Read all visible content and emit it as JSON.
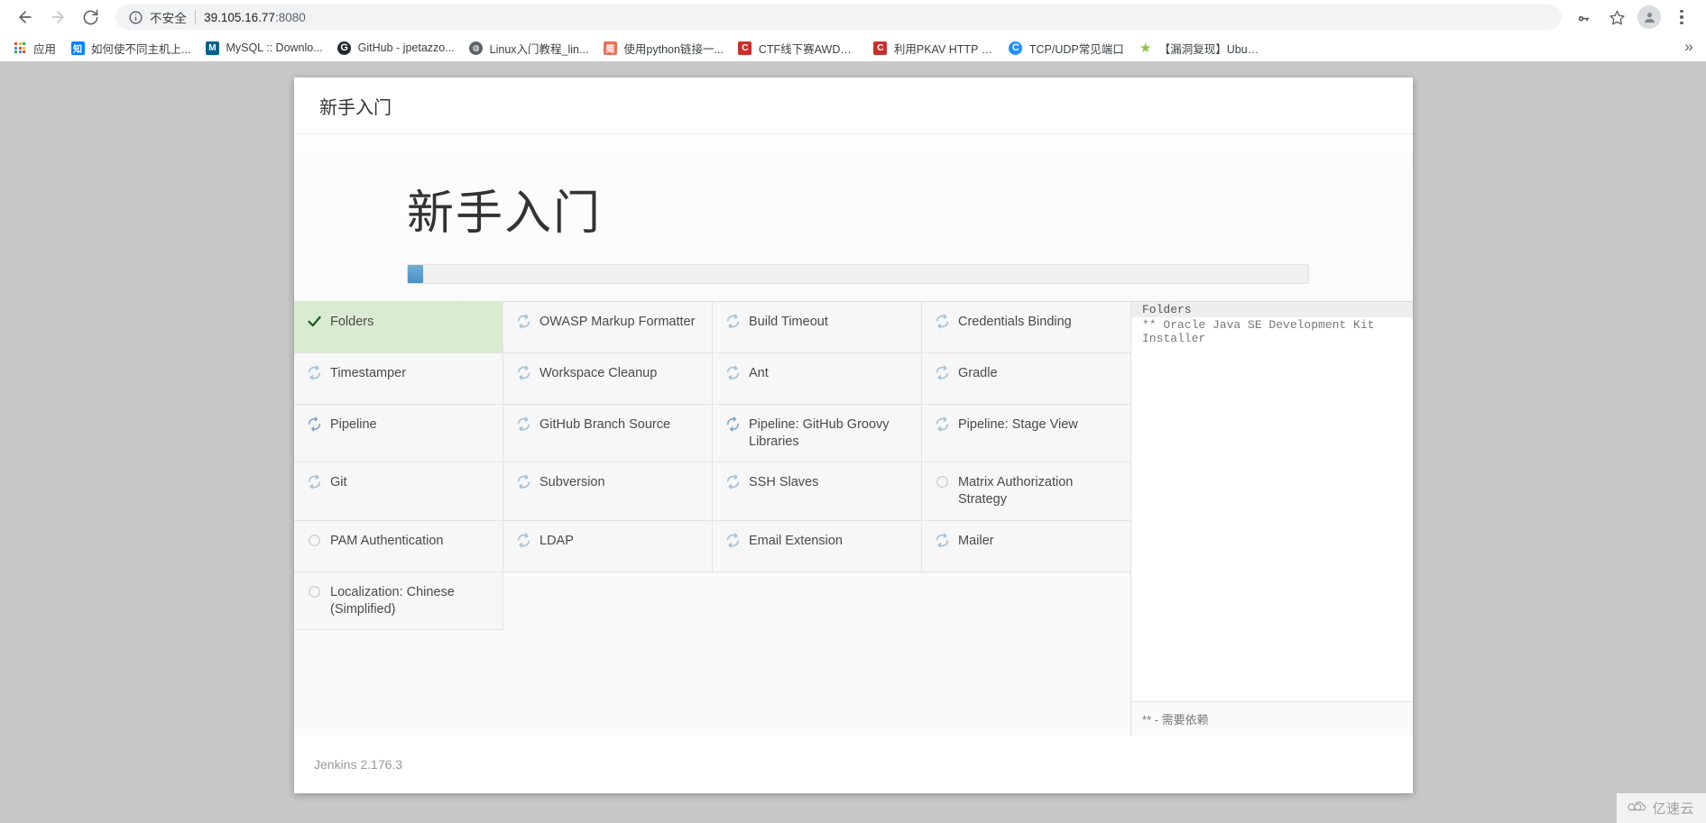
{
  "browser": {
    "back_label": "back-arrow",
    "forward_label": "forward-arrow",
    "reload_label": "reload",
    "security_text": "不安全",
    "url_host": "39.105.16.77",
    "url_port": ":8080",
    "key_icon": "password-key-icon",
    "star_icon": "bookmark-star-icon",
    "avatar_icon": "profile-avatar",
    "menu_icon": "three-dot-menu",
    "overflow_label": "»"
  },
  "bookmarks": {
    "apps_label": "应用",
    "items": [
      {
        "label": "如何使不同主机上...",
        "icon": "zhihu-icon",
        "color": "#1772f6",
        "glyph": "知"
      },
      {
        "label": "MySQL :: Downlo...",
        "icon": "mysql-icon",
        "color": "#00618a",
        "glyph": "M"
      },
      {
        "label": "GitHub - jpetazzo...",
        "icon": "github-icon",
        "color": "#24292e",
        "glyph": "G"
      },
      {
        "label": "Linux入门教程_lin...",
        "icon": "globe-icon",
        "color": "#4a4a4a",
        "glyph": "🌐"
      },
      {
        "label": "使用python链接一...",
        "icon": "jianshu-icon",
        "color": "#ea6f5a",
        "glyph": "简"
      },
      {
        "label": "CTF线下赛AWD总...",
        "icon": "csdn-icon",
        "color": "#c9302c",
        "glyph": "C"
      },
      {
        "label": "利用PKAV HTTP F...",
        "icon": "csdn-icon",
        "color": "#c9302c",
        "glyph": "C"
      },
      {
        "label": "TCP/UDP常见端口",
        "icon": "cnblogs-icon",
        "color": "#1e90ff",
        "glyph": "C"
      },
      {
        "label": "【漏洞复现】Ubun...",
        "icon": "star-icon",
        "color": "#8bc34a",
        "glyph": "★"
      }
    ]
  },
  "jenkins": {
    "header_title": "新手入门",
    "hero_title": "新手入门",
    "progress_percent": 1.7,
    "version": "Jenkins 2.176.3",
    "plugins": [
      {
        "name": "Folders",
        "status": "done"
      },
      {
        "name": "OWASP Markup Formatter",
        "status": "installing"
      },
      {
        "name": "Build Timeout",
        "status": "installing"
      },
      {
        "name": "Credentials Binding",
        "status": "installing"
      },
      {
        "name": "Timestamper",
        "status": "installing"
      },
      {
        "name": "Workspace Cleanup",
        "status": "installing"
      },
      {
        "name": "Ant",
        "status": "installing"
      },
      {
        "name": "Gradle",
        "status": "installing"
      },
      {
        "name": "Pipeline",
        "status": "spinning"
      },
      {
        "name": "GitHub Branch Source",
        "status": "installing"
      },
      {
        "name": "Pipeline: GitHub Groovy Libraries",
        "status": "spinning"
      },
      {
        "name": "Pipeline: Stage View",
        "status": "installing"
      },
      {
        "name": "Git",
        "status": "installing"
      },
      {
        "name": "Subversion",
        "status": "installing"
      },
      {
        "name": "SSH Slaves",
        "status": "installing"
      },
      {
        "name": "Matrix Authorization Strategy",
        "status": "pending"
      },
      {
        "name": "PAM Authentication",
        "status": "pending"
      },
      {
        "name": "LDAP",
        "status": "installing"
      },
      {
        "name": "Email Extension",
        "status": "installing"
      },
      {
        "name": "Mailer",
        "status": "installing"
      },
      {
        "name": "Localization: Chinese (Simplified)",
        "status": "pending"
      }
    ],
    "log": {
      "current": "Folders",
      "lines": [
        "** Oracle Java SE Development Kit Installer"
      ],
      "footer_note": "** - 需要依赖"
    }
  },
  "watermark": {
    "text": "亿速云",
    "icon": "cloud-icon"
  }
}
